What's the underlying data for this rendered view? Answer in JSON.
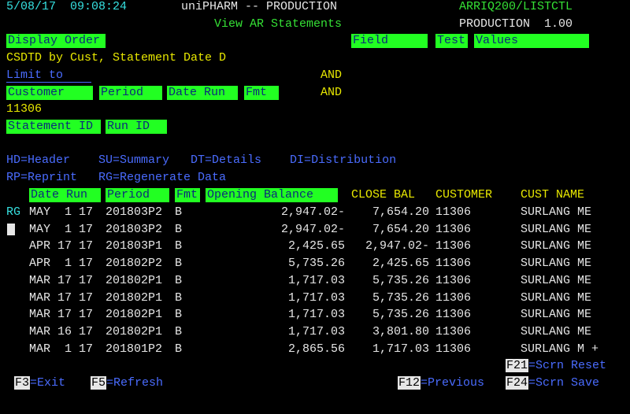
{
  "header": {
    "datetime": "5/08/17  09:08:24",
    "app": "uniPHARM -- PRODUCTION",
    "program": "ARRIQ200/LISTCTL",
    "screen_title": "View AR Statements",
    "env": "PRODUCTION  1.00"
  },
  "display_order": {
    "label": "Display Order",
    "value": "CSDTD by Cust, Statement Date D",
    "field_label": "Field",
    "test_label": "Test",
    "values_label": "Values"
  },
  "limit": {
    "label": "Limit to",
    "and1": "AND",
    "and2": "AND",
    "customer_label": "Customer",
    "period_label": "Period",
    "date_run_label": "Date Run",
    "fmt_label": "Fmt",
    "customer_value": "11306",
    "statement_id_label": "Statement ID",
    "run_id_label": "Run ID"
  },
  "legend": {
    "line1": "HD=Header    SU=Summary   DT=Details    DI=Distribution",
    "line2": "RP=Reprint   RG=Regenerate Data"
  },
  "columns": {
    "date_run": "Date Run",
    "period": "Period",
    "fmt": "Fmt",
    "opening": "Opening Balance",
    "close": "CLOSE BAL",
    "customer": "CUSTOMER",
    "cust_name": "CUST NAME"
  },
  "rows": [
    {
      "opt": "RG",
      "date": "MAY  1 17",
      "period": "201803P2",
      "fmt": "B",
      "open": "2,947.02-",
      "close": "7,654.20",
      "cust": "11306",
      "name": "SURLANG ME"
    },
    {
      "opt": "",
      "date": "MAY  1 17",
      "period": "201803P2",
      "fmt": "B",
      "open": "2,947.02-",
      "close": "7,654.20",
      "cust": "11306",
      "name": "SURLANG ME"
    },
    {
      "opt": "",
      "date": "APR 17 17",
      "period": "201803P1",
      "fmt": "B",
      "open": "2,425.65",
      "close": "2,947.02-",
      "cust": "11306",
      "name": "SURLANG ME"
    },
    {
      "opt": "",
      "date": "APR  1 17",
      "period": "201802P2",
      "fmt": "B",
      "open": "5,735.26",
      "close": "2,425.65",
      "cust": "11306",
      "name": "SURLANG ME"
    },
    {
      "opt": "",
      "date": "MAR 17 17",
      "period": "201802P1",
      "fmt": "B",
      "open": "1,717.03",
      "close": "5,735.26",
      "cust": "11306",
      "name": "SURLANG ME"
    },
    {
      "opt": "",
      "date": "MAR 17 17",
      "period": "201802P1",
      "fmt": "B",
      "open": "1,717.03",
      "close": "5,735.26",
      "cust": "11306",
      "name": "SURLANG ME"
    },
    {
      "opt": "",
      "date": "MAR 17 17",
      "period": "201802P1",
      "fmt": "B",
      "open": "1,717.03",
      "close": "5,735.26",
      "cust": "11306",
      "name": "SURLANG ME"
    },
    {
      "opt": "",
      "date": "MAR 16 17",
      "period": "201802P1",
      "fmt": "B",
      "open": "1,717.03",
      "close": "3,801.80",
      "cust": "11306",
      "name": "SURLANG ME"
    },
    {
      "opt": "",
      "date": "MAR  1 17",
      "period": "201801P2",
      "fmt": "B",
      "open": "2,865.56",
      "close": "1,717.03",
      "cust": "11306",
      "name": "SURLANG M +"
    }
  ],
  "fkeys": {
    "f21_key": "F21",
    "f21_label": "=Scrn Reset",
    "f3_key": "F3",
    "f3_label": "=Exit",
    "f5_key": "F5",
    "f5_label": "=Refresh",
    "f12_key": "F12",
    "f12_label": "=Previous",
    "f24_key": "F24",
    "f24_label": "=Scrn Save"
  }
}
